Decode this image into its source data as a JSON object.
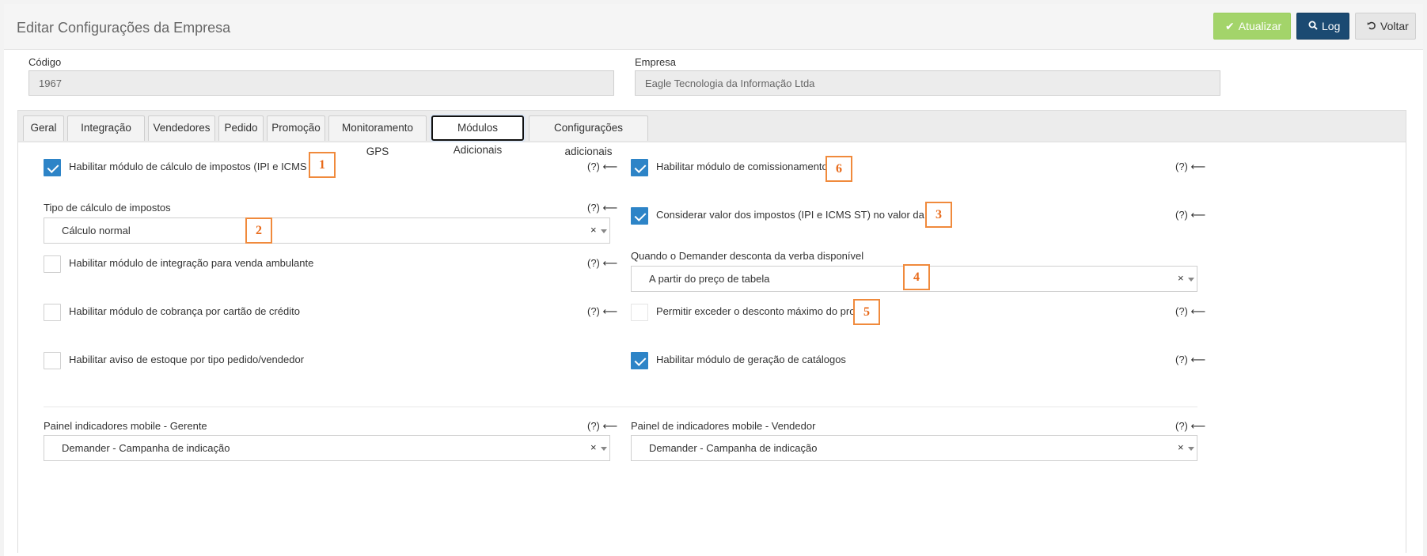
{
  "header": {
    "title": "Editar Configurações da Empresa",
    "buttons": {
      "update": "Atualizar",
      "log": "Log",
      "back": "Voltar"
    }
  },
  "company": {
    "code_label": "Código",
    "code_value": "1967",
    "name_label": "Empresa",
    "name_value": "Eagle Tecnologia da Informação Ltda"
  },
  "tabs": [
    {
      "label": "Geral"
    },
    {
      "label": "Integração"
    },
    {
      "label": "Vendedores"
    },
    {
      "label": "Pedido"
    },
    {
      "label": "Promoção"
    },
    {
      "label": "Monitoramento GPS"
    },
    {
      "label": "Módulos Adicionais",
      "active": true
    },
    {
      "label": "Configurações adicionais"
    }
  ],
  "help_text": "(?) ⟵",
  "left": {
    "tax_module": {
      "label": "Habilitar módulo de cálculo de impostos (IPI e ICMS ST)",
      "checked": true
    },
    "tax_type": {
      "label": "Tipo de cálculo de impostos",
      "value": "Cálculo normal"
    },
    "street_sale": {
      "label": "Habilitar módulo de integração para venda ambulante",
      "checked": false
    },
    "credit_card": {
      "label": "Habilitar módulo de cobrança por cartão de crédito",
      "checked": false
    },
    "stock_warning": {
      "label": "Habilitar aviso de estoque por tipo pedido/vendedor",
      "checked": false
    },
    "manager_panel": {
      "label": "Painel indicadores mobile - Gerente",
      "value": "Demander - Campanha de indicação"
    }
  },
  "right": {
    "commission": {
      "label": "Habilitar módulo de comissionamento",
      "checked": true
    },
    "tax_goal": {
      "label": "Considerar valor dos impostos (IPI e ICMS ST) no valor da meta",
      "checked": true
    },
    "discount_when": {
      "label": "Quando o Demander desconta da verba disponível",
      "value": "A partir do preço de tabela"
    },
    "exceed_discount": {
      "label": "Permitir exceder o desconto máximo do produto",
      "checked": false
    },
    "catalogs": {
      "label": "Habilitar módulo de geração de catálogos",
      "checked": true
    },
    "seller_panel": {
      "label": "Painel de indicadores mobile - Vendedor",
      "value": "Demander - Campanha de indicação"
    }
  },
  "select_clear": "×",
  "annotations": [
    "1",
    "2",
    "3",
    "4",
    "5",
    "6"
  ],
  "colors": {
    "update_btn": "#a3d46a",
    "log_btn": "#1b4a72",
    "checkbox_on": "#2d84c7",
    "annotation": "#f08a3c"
  }
}
